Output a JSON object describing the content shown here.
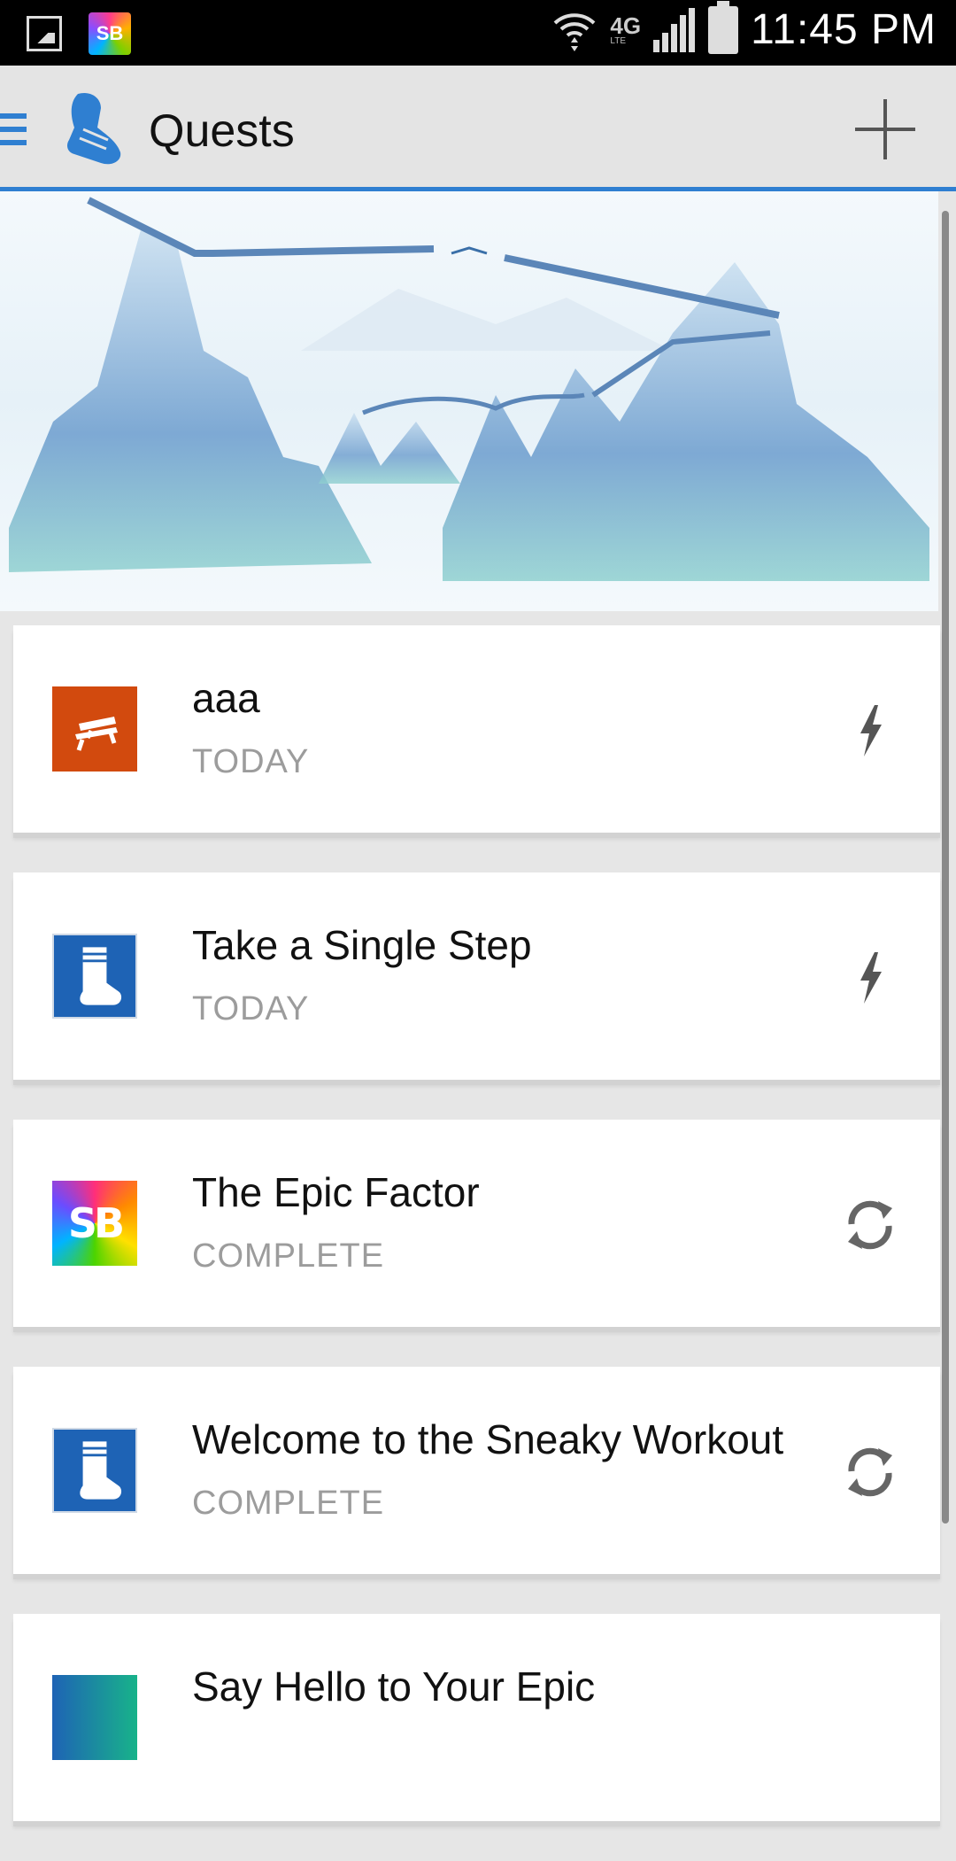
{
  "status_bar": {
    "time": "11:45 PM",
    "network": "4G",
    "network_sub": "LTE",
    "notification_icons": [
      "gallery-icon",
      "superbetter-app-icon"
    ],
    "app_icon_text": "SB"
  },
  "action_bar": {
    "title": "Quests",
    "accent": "#2f7fd1",
    "icons": [
      "hamburger-menu-icon",
      "sneaker-logo-icon",
      "add-icon"
    ]
  },
  "banner": {
    "description_icon": "mountain-bridges-illustration"
  },
  "quests": [
    {
      "title": "aaa",
      "status": "TODAY",
      "thumb": "bench-icon",
      "thumb_color": "#d24a0e",
      "action_icon": "lightning-icon"
    },
    {
      "title": "Take a Single Step",
      "status": "TODAY",
      "thumb": "sock-icon",
      "thumb_color": "#1e63b5",
      "action_icon": "lightning-icon"
    },
    {
      "title": "The Epic Factor",
      "status": "COMPLETE",
      "thumb": "superbetter-logo-icon",
      "thumb_text": "SB",
      "action_icon": "repeat-icon"
    },
    {
      "title": "Welcome to the Sneaky Workout",
      "status": "COMPLETE",
      "thumb": "sock-icon",
      "thumb_color": "#1e63b5",
      "action_icon": "repeat-icon"
    },
    {
      "title": "Say Hello to Your Epic",
      "status": "",
      "thumb": "quest-thumbnail",
      "action_icon": ""
    }
  ]
}
